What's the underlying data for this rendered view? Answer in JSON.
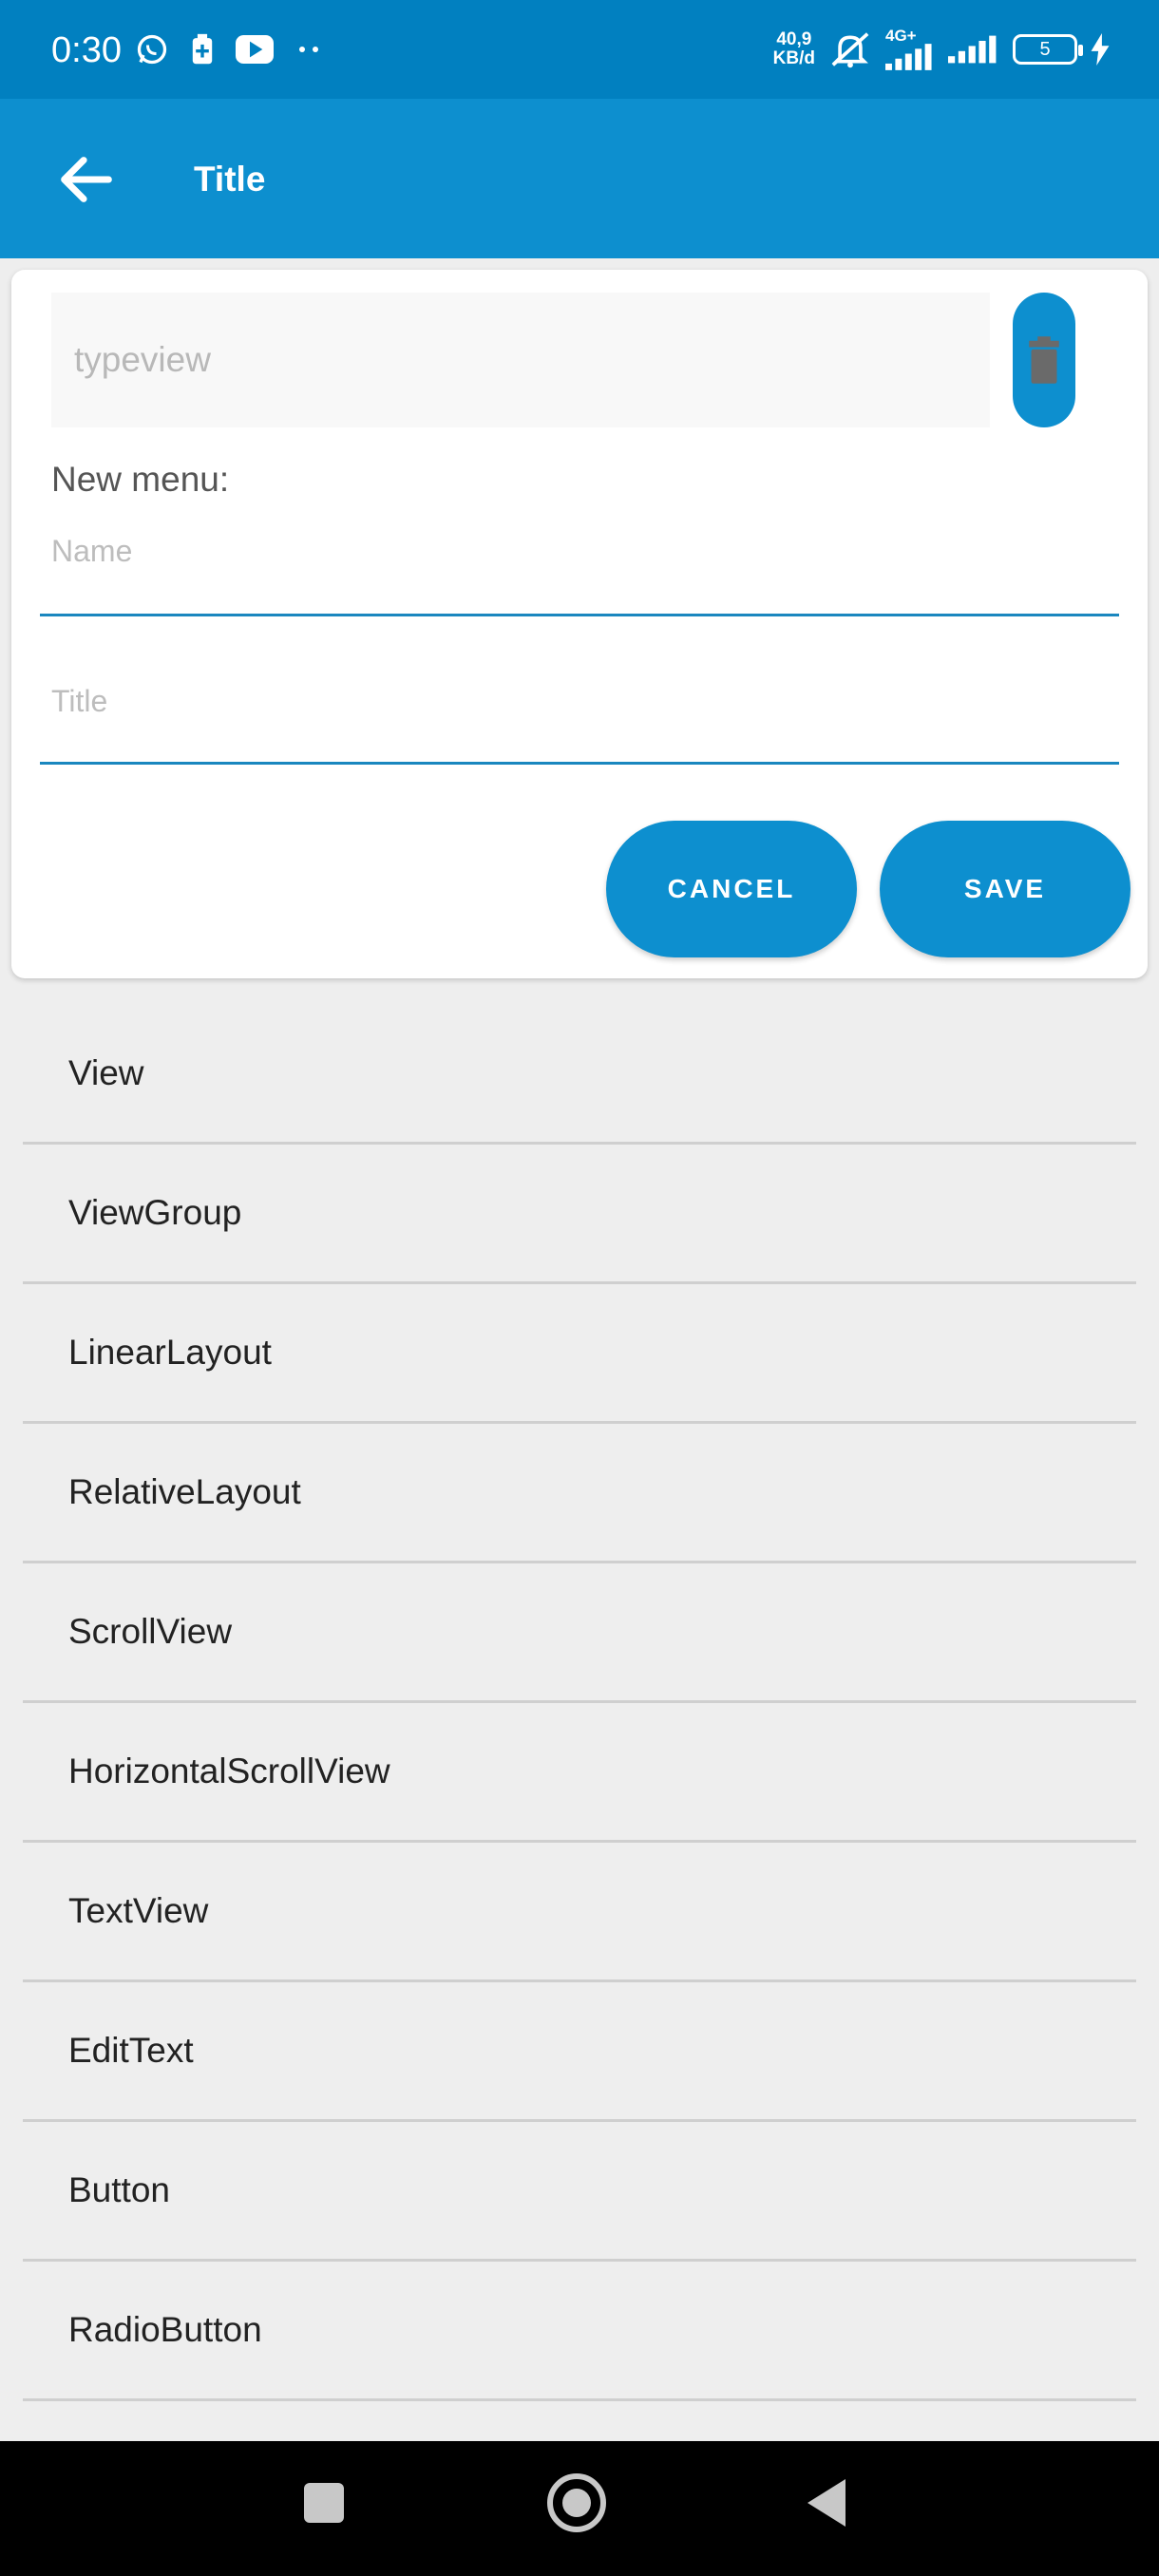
{
  "status_bar": {
    "time": "0:30",
    "net_speed_value": "40,9",
    "net_speed_unit": "KB/d",
    "network_label": "4G+",
    "battery_level": "5",
    "icons": [
      "whatsapp-icon",
      "battery-saver-icon",
      "youtube-icon",
      "more-dots-icon",
      "mute-icon",
      "signal-icon",
      "signal-icon",
      "charging-icon"
    ]
  },
  "app_bar": {
    "title": "Title",
    "back_icon": "arrow-back-icon"
  },
  "form": {
    "type_placeholder": "typeview",
    "delete_icon": "trash-icon",
    "section_label": "New menu:",
    "name_placeholder": "Name",
    "title_placeholder": "Title",
    "cancel_label": "CANCEL",
    "save_label": "SAVE"
  },
  "menu_items": [
    "View",
    "ViewGroup",
    "LinearLayout",
    "RelativeLayout",
    "ScrollView",
    "HorizontalScrollView",
    "TextView",
    "EditText",
    "Button",
    "RadioButton"
  ],
  "colors": {
    "status_bar": "#0180c0",
    "app_bar": "#0d8fcf",
    "accent": "#0d8fcf",
    "background": "#eeeeee"
  }
}
